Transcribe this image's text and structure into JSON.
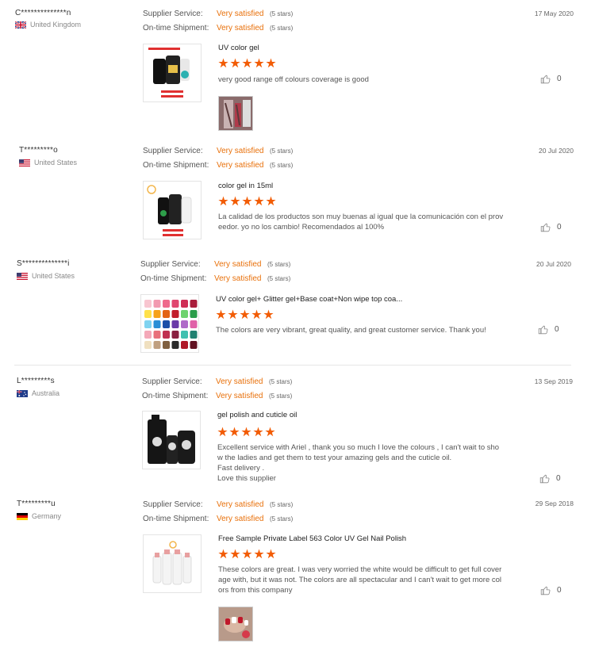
{
  "labels": {
    "supplier_service": "Supplier Service:",
    "ontime_shipment": "On-time Shipment:"
  },
  "reviews": [
    {
      "buyer": "C**************n",
      "country": "United Kingdom",
      "flag": "uk",
      "date": "17 May 2020",
      "supplier_value": "Very satisfied",
      "supplier_stars": "(5 stars)",
      "shipment_value": "Very satisfied",
      "shipment_stars": "(5 stars)",
      "product_title": "UV color gel",
      "rating": 5,
      "text": "very good range off colours coverage is good",
      "likes": "0",
      "has_photo": true
    },
    {
      "buyer": "T*********o",
      "country": "United States",
      "flag": "us",
      "date": "20 Jul 2020",
      "supplier_value": "Very satisfied",
      "supplier_stars": "(5 stars)",
      "shipment_value": "Very satisfied",
      "shipment_stars": "(5 stars)",
      "product_title": "color gel in 15ml",
      "rating": 5,
      "text": "La calidad de los productos son muy buenas al igual que la comunicación con el proveedor. yo no los cambio! Recomendados al 100%",
      "likes": "0",
      "has_photo": false
    },
    {
      "buyer": "S**************i",
      "country": "United States",
      "flag": "us",
      "date": "20 Jul 2020",
      "supplier_value": "Very satisfied",
      "supplier_stars": "(5 stars)",
      "shipment_value": "Very satisfied",
      "shipment_stars": "(5 stars)",
      "product_title": "UV color gel+ Glitter gel+Base coat+Non wipe top coa...",
      "rating": 5,
      "text": "The colors are very vibrant, great quality, and great customer service. Thank you!",
      "likes": "0",
      "has_photo": false
    },
    {
      "buyer": "L*********s",
      "country": "Australia",
      "flag": "au",
      "date": "13 Sep 2019",
      "supplier_value": "Very satisfied",
      "supplier_stars": "(5 stars)",
      "shipment_value": "Very satisfied",
      "shipment_stars": "(5 stars)",
      "product_title": "gel polish and cuticle oil",
      "rating": 5,
      "text": "Excellent service with Ariel , thank you so much I love the colours , I can't wait to show the ladies and get them to test your amazing gels and the cuticle oil.\nFast delivery .\nLove this supplier",
      "likes": "0",
      "has_photo": false
    },
    {
      "buyer": "T*********u",
      "country": "Germany",
      "flag": "de",
      "date": "29 Sep 2018",
      "supplier_value": "Very satisfied",
      "supplier_stars": "(5 stars)",
      "shipment_value": "Very satisfied",
      "shipment_stars": "(5 stars)",
      "product_title": "Free Sample Private Label 563 Color UV Gel Nail Polish",
      "rating": 5,
      "text": "These colors are great. I was very worried the white would be difficult to get full coverage with, but it was not. The colors are all spectacular and I can't wait to get more colors from this company",
      "likes": "0",
      "has_photo": true
    }
  ],
  "colors": {
    "accent": "#f25c05",
    "satisfied": "#e8700a"
  }
}
